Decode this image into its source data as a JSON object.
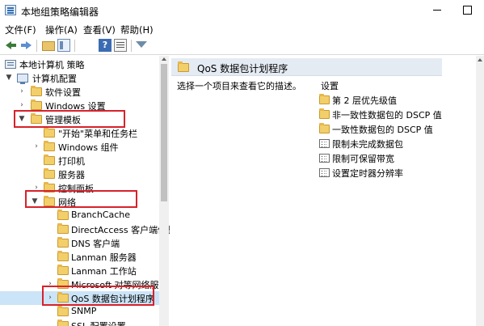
{
  "window": {
    "title": "本地组策略编辑器"
  },
  "menu": [
    "文件(F)",
    "操作(A)",
    "查看(V)",
    "帮助(H)"
  ],
  "toolbar": {
    "icons": [
      "back-arrow-icon",
      "forward-arrow-icon",
      "folder-up-icon",
      "show-hide-tree-icon",
      "help-icon",
      "properties-icon",
      "filter-icon"
    ],
    "help_glyph": "?"
  },
  "tree": {
    "items": [
      {
        "label": "本地计算机 策略",
        "expander": "",
        "icon": "policy-icon"
      },
      {
        "label": "计算机配置",
        "expander": "▼",
        "icon": "computer-icon"
      },
      {
        "label": "软件设置",
        "expander": "›",
        "icon": "folder-icon"
      },
      {
        "label": "Windows 设置",
        "expander": "›",
        "icon": "folder-icon"
      },
      {
        "label": "管理模板",
        "expander": "▼",
        "icon": "folder-icon"
      },
      {
        "label": "\"开始\"菜单和任务栏",
        "expander": "",
        "icon": "folder-icon"
      },
      {
        "label": "Windows 组件",
        "expander": "›",
        "icon": "folder-icon"
      },
      {
        "label": "打印机",
        "expander": "",
        "icon": "folder-icon"
      },
      {
        "label": "服务器",
        "expander": "",
        "icon": "folder-icon"
      },
      {
        "label": "控制面板",
        "expander": "›",
        "icon": "folder-icon"
      },
      {
        "label": "网络",
        "expander": "▼",
        "icon": "folder-icon"
      },
      {
        "label": "BranchCache",
        "expander": "",
        "icon": "folder-icon"
      },
      {
        "label": "DirectAccess 客户端体验",
        "expander": "",
        "icon": "folder-icon"
      },
      {
        "label": "DNS 客户端",
        "expander": "",
        "icon": "folder-icon"
      },
      {
        "label": "Lanman 服务器",
        "expander": "",
        "icon": "folder-icon"
      },
      {
        "label": "Lanman 工作站",
        "expander": "",
        "icon": "folder-icon"
      },
      {
        "label": "Microsoft 对等网络服务",
        "expander": "›",
        "icon": "folder-icon"
      },
      {
        "label": "QoS 数据包计划程序",
        "expander": "›",
        "icon": "folder-icon"
      },
      {
        "label": "SNMP",
        "expander": "",
        "icon": "folder-icon"
      },
      {
        "label": "SSL 配置设置",
        "expander": "",
        "icon": "folder-icon"
      }
    ],
    "selected": "QoS 数据包计划程序"
  },
  "right_pane": {
    "header": "QoS 数据包计划程序",
    "description": "选择一个项目来查看它的描述。",
    "settings_header": "设置",
    "settings": [
      {
        "label": "第 2 层优先级值",
        "icon": "folder-icon"
      },
      {
        "label": "非一致性数据包的 DSCP 值",
        "icon": "folder-icon"
      },
      {
        "label": "一致性数据包的 DSCP 值",
        "icon": "folder-icon"
      },
      {
        "label": "限制未完成数据包",
        "icon": "policy-setting-icon"
      },
      {
        "label": "限制可保留带宽",
        "icon": "policy-setting-icon"
      },
      {
        "label": "设置定时器分辨率",
        "icon": "policy-setting-icon"
      }
    ]
  },
  "annotation_color": "#d8222a"
}
